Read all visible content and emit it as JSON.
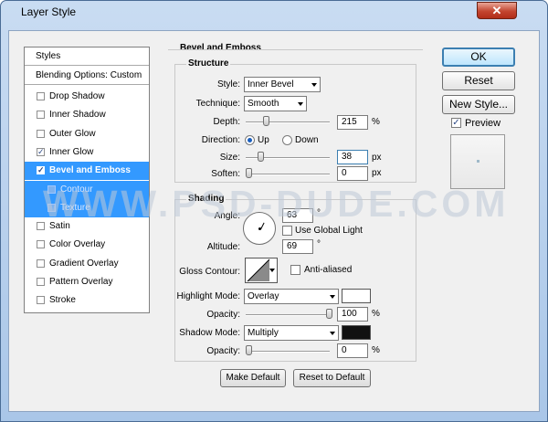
{
  "window": {
    "title": "Layer Style",
    "close_glyph": "✕"
  },
  "styles_list": {
    "header": "Styles",
    "blending": "Blending Options: Custom",
    "items": [
      {
        "label": "Drop Shadow",
        "checked": false
      },
      {
        "label": "Inner Shadow",
        "checked": false
      },
      {
        "label": "Outer Glow",
        "checked": false
      },
      {
        "label": "Inner Glow",
        "checked": true
      },
      {
        "label": "Bevel and Emboss",
        "checked": true,
        "selected": true
      },
      {
        "label": "Contour",
        "checked": false,
        "sub": true
      },
      {
        "label": "Texture",
        "checked": false,
        "sub": true
      },
      {
        "label": "Satin",
        "checked": false
      },
      {
        "label": "Color Overlay",
        "checked": false
      },
      {
        "label": "Gradient Overlay",
        "checked": false
      },
      {
        "label": "Pattern Overlay",
        "checked": false
      },
      {
        "label": "Stroke",
        "checked": false
      }
    ]
  },
  "bevel": {
    "title": "Bevel and Emboss",
    "structure_title": "Structure",
    "style_label": "Style:",
    "style_value": "Inner Bevel",
    "technique_label": "Technique:",
    "technique_value": "Smooth",
    "depth_label": "Depth:",
    "depth_value": "215",
    "depth_unit": "%",
    "direction_label": "Direction:",
    "dir_up": "Up",
    "dir_down": "Down",
    "direction_selected": "Up",
    "size_label": "Size:",
    "size_value": "38",
    "size_unit": "px",
    "soften_label": "Soften:",
    "soften_value": "0",
    "soften_unit": "px"
  },
  "shading": {
    "title": "Shading",
    "angle_label": "Angle:",
    "angle_value": "63",
    "angle_unit": "°",
    "global_light_label": "Use Global Light",
    "global_light_checked": false,
    "altitude_label": "Altitude:",
    "altitude_value": "69",
    "altitude_unit": "°",
    "gloss_label": "Gloss Contour:",
    "anti_aliased_label": "Anti-aliased",
    "anti_aliased_checked": false,
    "highlight_mode_label": "Highlight Mode:",
    "highlight_mode_value": "Overlay",
    "highlight_color": "#ffffff",
    "highlight_opacity_label": "Opacity:",
    "highlight_opacity_value": "100",
    "highlight_opacity_unit": "%",
    "shadow_mode_label": "Shadow Mode:",
    "shadow_mode_value": "Multiply",
    "shadow_color": "#111111",
    "shadow_opacity_label": "Opacity:",
    "shadow_opacity_value": "0",
    "shadow_opacity_unit": "%"
  },
  "buttons": {
    "ok": "OK",
    "reset": "Reset",
    "new_style": "New Style...",
    "preview_label": "Preview",
    "preview_checked": true,
    "make_default": "Make Default",
    "reset_default": "Reset to Default"
  },
  "watermark": "WWW.PSD-DUDE.COM",
  "sliders": {
    "depth": 0.215,
    "size": 0.15,
    "soften": 0.0,
    "highlight_opacity": 1.0,
    "shadow_opacity": 0.0
  },
  "colors": {
    "selection": "#3399ff",
    "window_frame": "#a9c6e8",
    "close": "#c3452f"
  }
}
